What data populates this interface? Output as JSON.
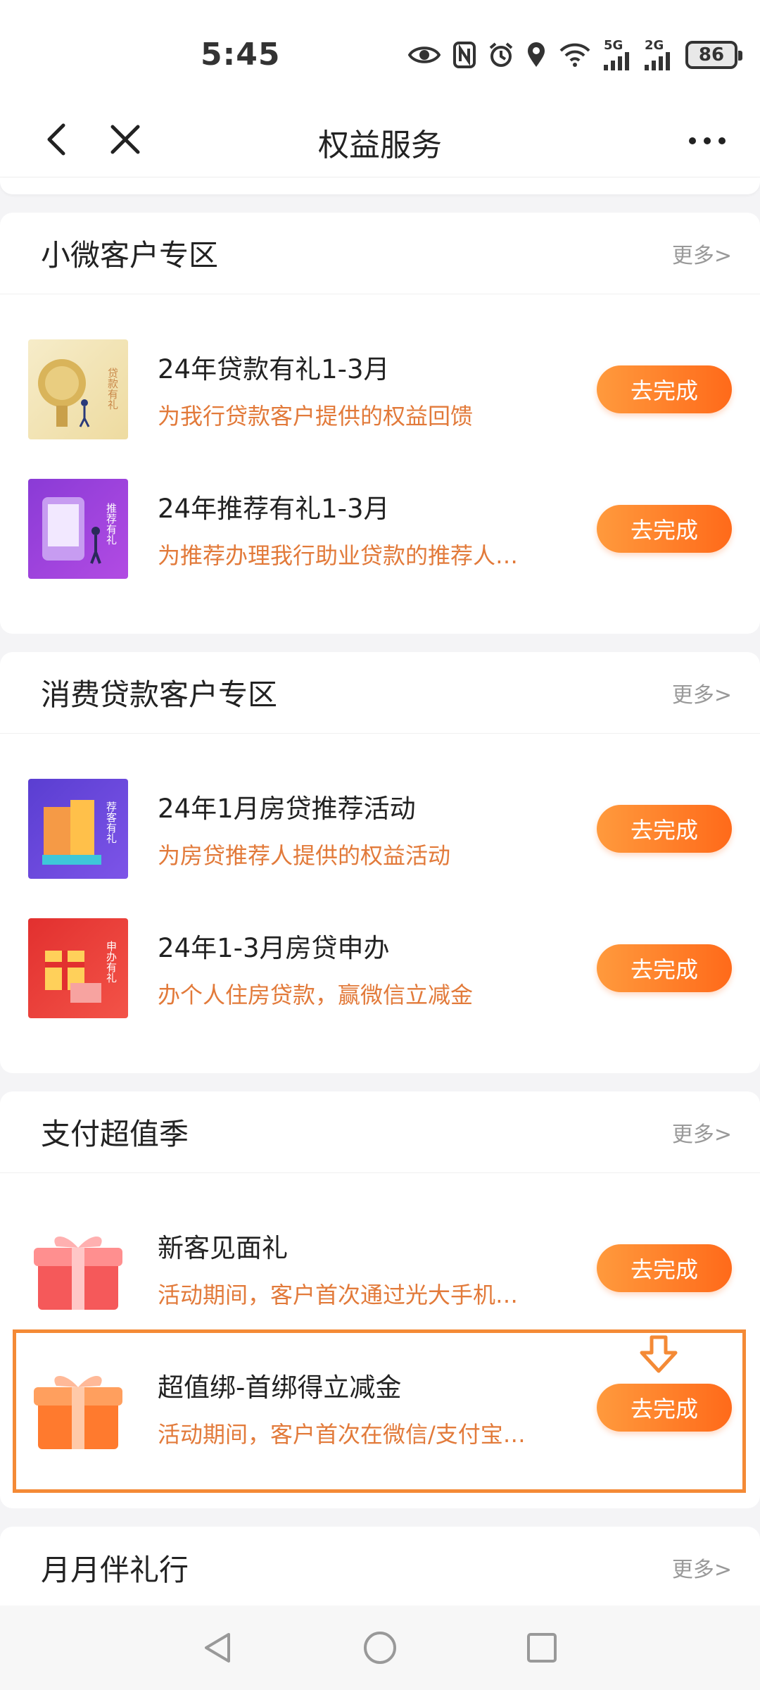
{
  "status_bar": {
    "time": "5:45",
    "net1": "5G",
    "net2": "2G",
    "battery": "86",
    "icons": [
      "eye-icon",
      "nfc-icon",
      "alarm-icon",
      "location-icon",
      "wifi-icon",
      "signal-5g-icon",
      "signal-2g-icon",
      "battery-icon"
    ]
  },
  "nav": {
    "title": "权益服务",
    "back_icon": "back-arrow-icon",
    "close_icon": "close-icon",
    "more_icon": "more-dots-icon"
  },
  "accent": "#ff7a2a",
  "desc_color": "#e27a3a",
  "sections": [
    {
      "title": "小微客户专区",
      "more": "更多>",
      "items": [
        {
          "title": "24年贷款有礼1-3月",
          "desc": "为我行贷款客户提供的权益回馈",
          "button": "去完成",
          "thumb_text": "贷款有礼"
        },
        {
          "title": "24年推荐有礼1-3月",
          "desc": "为推荐办理我行助业贷款的推荐人…",
          "button": "去完成",
          "thumb_text": "推荐有礼"
        }
      ]
    },
    {
      "title": "消费贷款客户专区",
      "more": "更多>",
      "items": [
        {
          "title": "24年1月房贷推荐活动",
          "desc": "为房贷推荐人提供的权益活动",
          "button": "去完成",
          "thumb_text": "荐客有礼"
        },
        {
          "title": "24年1-3月房贷申办",
          "desc": "办个人住房贷款，赢微信立减金",
          "button": "去完成",
          "thumb_text": "申办有礼"
        }
      ]
    },
    {
      "title": "支付超值季",
      "more": "更多>",
      "items": [
        {
          "title": "新客见面礼",
          "desc": "活动期间，客户首次通过光大手机…",
          "button": "去完成"
        },
        {
          "title": "超值绑-首绑得立减金",
          "desc": "活动期间，客户首次在微信/支付宝…",
          "button": "去完成"
        }
      ]
    },
    {
      "title": "月月伴礼行",
      "more": "更多>"
    }
  ],
  "system_nav": [
    "back-triangle-icon",
    "home-circle-icon",
    "recents-square-icon"
  ]
}
